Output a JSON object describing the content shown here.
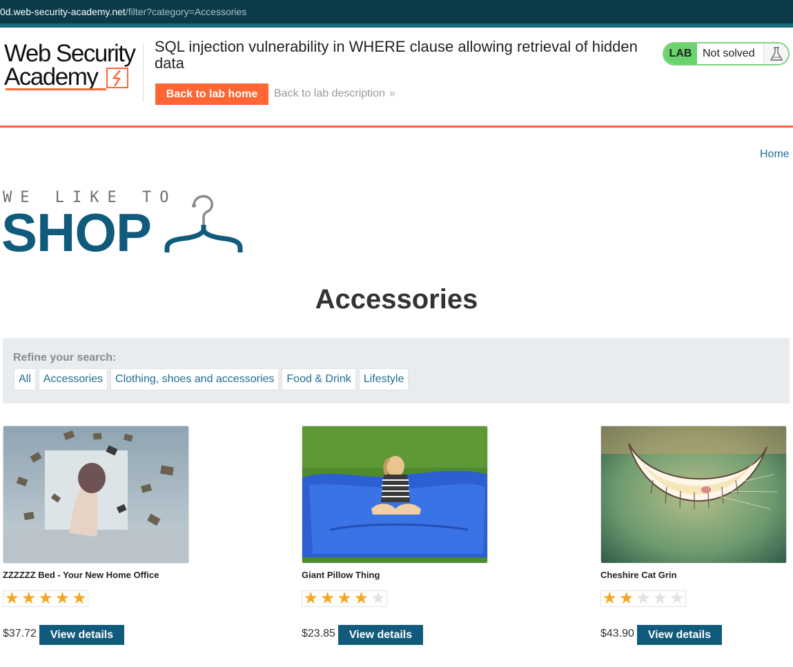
{
  "browser": {
    "url_host": "0d.web-security-academy.net",
    "url_path": "/filter?category=Accessories"
  },
  "academy": {
    "logo_line1": "Web Security",
    "logo_line2": "Academy",
    "lab_title": "SQL injection vulnerability in WHERE clause allowing retrieval of hidden data",
    "back_home_label": "Back to lab home",
    "back_desc_label": "Back to lab description",
    "back_desc_chevron": "»",
    "lab_badge": "LAB",
    "lab_status": "Not solved",
    "flask_icon": "flask-icon",
    "accent_color": "#ff6633"
  },
  "site": {
    "home_label": "Home",
    "logo_tagline": "WE LIKE TO",
    "logo_word": "SHOP",
    "logo_icon": "hanger-icon",
    "page_heading": "Accessories",
    "brand_color": "#105a7c"
  },
  "filter": {
    "label": "Refine your search:",
    "links": [
      "All",
      "Accessories",
      "Clothing, shoes and accessories",
      "Food & Drink",
      "Lifestyle"
    ]
  },
  "products": [
    {
      "name": "ZZZZZZ Bed - Your New Home Office",
      "rating": 5,
      "price": "$37.72",
      "button": "View details"
    },
    {
      "name": "Giant Pillow Thing",
      "rating": 4,
      "price": "$23.85",
      "button": "View details"
    },
    {
      "name": "Cheshire Cat Grin",
      "rating": 2,
      "price": "$43.90",
      "button": "View details"
    }
  ]
}
